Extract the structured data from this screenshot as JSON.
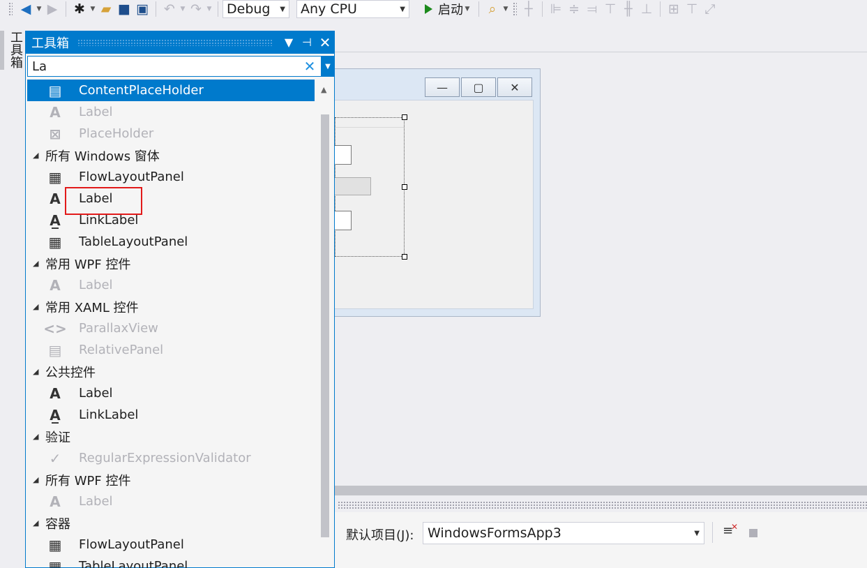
{
  "toolbar": {
    "config": "Debug",
    "platform": "Any CPU",
    "start_label": "启动"
  },
  "side_tab": {
    "label": "工具箱"
  },
  "toolbox": {
    "title": "工具箱",
    "search_value": "La",
    "rows": [
      {
        "type": "item",
        "label": "ContentPlaceHolder",
        "icon": "content-placeholder-icon",
        "glyph": "▤",
        "state": "selected"
      },
      {
        "type": "item",
        "label": "Label",
        "icon": "label-icon",
        "glyph": "A",
        "state": "disabled"
      },
      {
        "type": "item",
        "label": "PlaceHolder",
        "icon": "placeholder-icon",
        "glyph": "⊠",
        "state": "disabled"
      },
      {
        "type": "category",
        "label": "所有 Windows 窗体"
      },
      {
        "type": "item",
        "label": "FlowLayoutPanel",
        "icon": "flow-layout-panel-icon",
        "glyph": "▦",
        "state": "normal"
      },
      {
        "type": "item",
        "label": "Label",
        "icon": "label-icon",
        "glyph": "A",
        "state": "normal"
      },
      {
        "type": "item",
        "label": "LinkLabel",
        "icon": "link-label-icon",
        "glyph": "A̲",
        "state": "normal"
      },
      {
        "type": "item",
        "label": "TableLayoutPanel",
        "icon": "table-layout-panel-icon",
        "glyph": "▦",
        "state": "normal"
      },
      {
        "type": "category",
        "label": "常用 WPF 控件"
      },
      {
        "type": "item",
        "label": "Label",
        "icon": "label-icon",
        "glyph": "A",
        "state": "disabled"
      },
      {
        "type": "category",
        "label": "常用 XAML 控件"
      },
      {
        "type": "item",
        "label": "ParallaxView",
        "icon": "parallax-view-icon",
        "glyph": "<>",
        "state": "disabled"
      },
      {
        "type": "item",
        "label": "RelativePanel",
        "icon": "relative-panel-icon",
        "glyph": "▤",
        "state": "disabled"
      },
      {
        "type": "category",
        "label": "公共控件"
      },
      {
        "type": "item",
        "label": "Label",
        "icon": "label-icon",
        "glyph": "A",
        "state": "normal"
      },
      {
        "type": "item",
        "label": "LinkLabel",
        "icon": "link-label-icon",
        "glyph": "A̲",
        "state": "normal"
      },
      {
        "type": "category",
        "label": "验证"
      },
      {
        "type": "item",
        "label": "RegularExpressionValidator",
        "icon": "regex-validator-icon",
        "glyph": "✓",
        "state": "disabled"
      },
      {
        "type": "category",
        "label": "所有 WPF 控件"
      },
      {
        "type": "item",
        "label": "Label",
        "icon": "label-icon",
        "glyph": "A",
        "state": "disabled"
      },
      {
        "type": "category",
        "label": "容器"
      },
      {
        "type": "item",
        "label": "FlowLayoutPanel",
        "icon": "flow-layout-panel-icon",
        "glyph": "▦",
        "state": "normal"
      },
      {
        "type": "item",
        "label": "TableLayoutPanel",
        "icon": "table-layout-panel-icon",
        "glyph": "▦",
        "state": "normal"
      }
    ]
  },
  "bottom_panel": {
    "default_project_label": "默认项目(J):",
    "default_project_value": "WindowsFormsApp3"
  },
  "colors": {
    "accent": "#007acc",
    "highlight_box": "#e21a1a",
    "run_green": "#1c8a1c"
  }
}
